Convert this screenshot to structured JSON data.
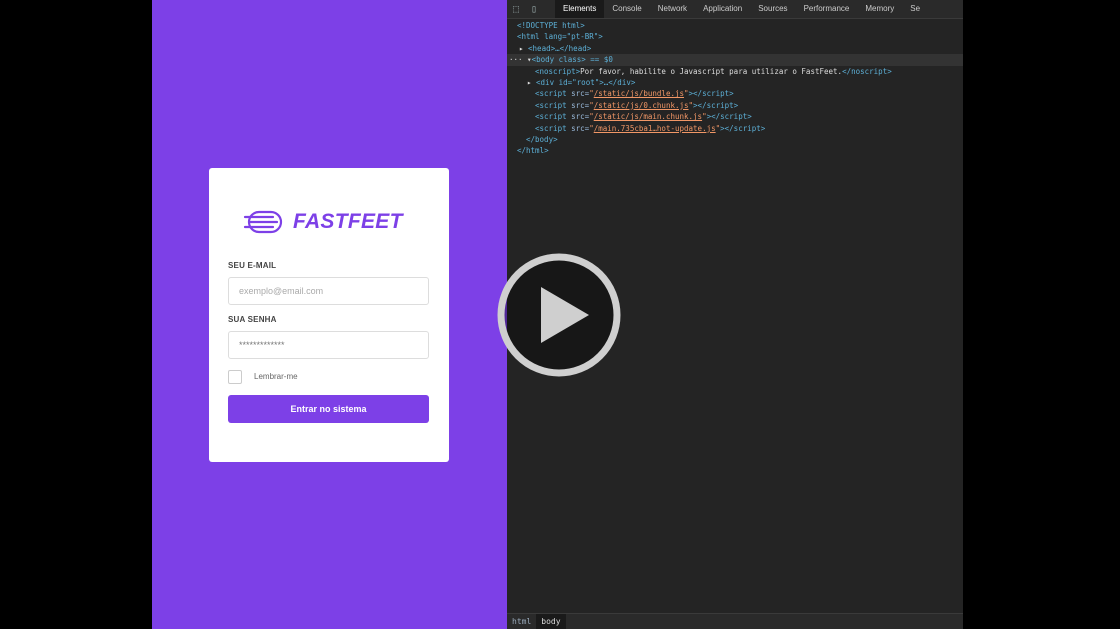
{
  "login": {
    "brand": "FASTFEET",
    "email_label": "SEU E-MAIL",
    "email_placeholder": "exemplo@email.com",
    "password_label": "SUA SENHA",
    "password_value": "*************",
    "remember_label": "Lembrar-me",
    "submit_label": "Entrar no sistema",
    "accent_color": "#7d40e7"
  },
  "devtools": {
    "tabs": [
      {
        "label": "Elements",
        "active": true
      },
      {
        "label": "Console"
      },
      {
        "label": "Network"
      },
      {
        "label": "Application"
      },
      {
        "label": "Sources"
      },
      {
        "label": "Performance"
      },
      {
        "label": "Memory"
      },
      {
        "label": "Se"
      }
    ],
    "dom": {
      "doctype": "<!DOCTYPE html>",
      "html_open": "<html lang=\"pt-BR\">",
      "head": "<head>…</head>",
      "body_open": "<body class> == $0",
      "noscript_text": "Por favor, habilite o Javascript para utilizar o FastFeet.",
      "root_div": "<div id=\"root\">…</div>",
      "scripts": [
        "/static/js/bundle.js",
        "/static/js/0.chunk.js",
        "/static/js/main.chunk.js",
        "/main.735cba1…hot-update.js"
      ],
      "body_close": "</body>",
      "html_close": "</html>"
    },
    "breadcrumbs": [
      "html",
      "body"
    ]
  },
  "video": {
    "play_icon": "play-icon"
  }
}
